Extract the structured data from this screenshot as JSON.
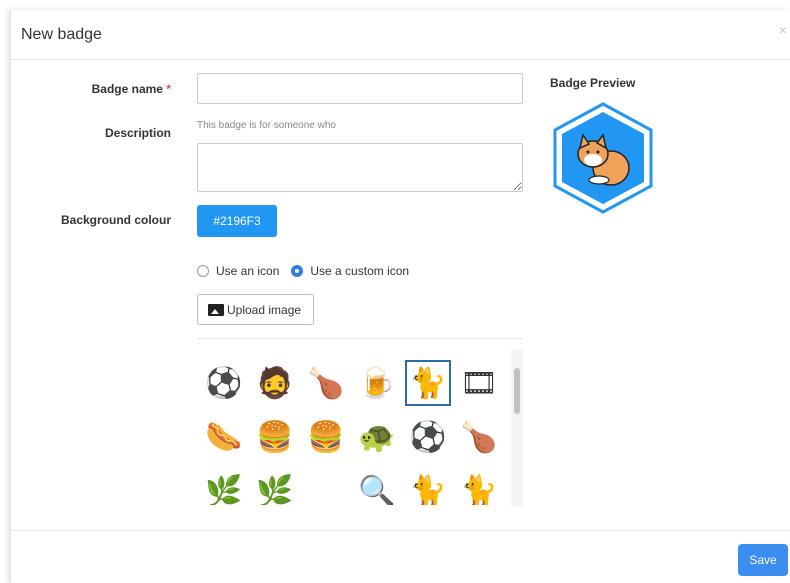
{
  "modal": {
    "title": "New badge",
    "close_glyph": "×"
  },
  "form": {
    "name_label": "Badge name",
    "required_mark": "*",
    "name_value": "",
    "description_label": "Description",
    "description_help": "This badge is for someone who",
    "description_value": "",
    "background_label": "Background colour",
    "background_value": "#2196F3",
    "icon_options": [
      {
        "label": "Use an icon",
        "checked": false
      },
      {
        "label": "Use a custom icon",
        "checked": true
      }
    ],
    "upload_label": "Upload image"
  },
  "icons": [
    {
      "name": "soccer-ball-icon",
      "glyph": "⚽"
    },
    {
      "name": "bearded-man-icon",
      "glyph": "🧔"
    },
    {
      "name": "drumstick-icon",
      "glyph": "🍗"
    },
    {
      "name": "pint-glass-icon",
      "glyph": "🍺"
    },
    {
      "name": "cat-icon",
      "glyph": "🐈",
      "selected": true
    },
    {
      "name": "film-reel-icon",
      "glyph": "🎞"
    },
    {
      "name": "hotdog-icon",
      "glyph": "🌭"
    },
    {
      "name": "burger-icon",
      "glyph": "🍔"
    },
    {
      "name": "burger-icon",
      "glyph": "🍔"
    },
    {
      "name": "turtle-icon",
      "glyph": "🐢"
    },
    {
      "name": "soccer-ball-icon",
      "glyph": "⚽"
    },
    {
      "name": "drumstick-icon",
      "glyph": "🍗"
    },
    {
      "name": "partial-icon",
      "glyph": "🌿"
    },
    {
      "name": "partial-icon",
      "glyph": "🌿"
    },
    {
      "name": "partial-icon",
      "glyph": ""
    },
    {
      "name": "partial-icon",
      "glyph": "🔍"
    },
    {
      "name": "cat-icon",
      "glyph": "🐈"
    },
    {
      "name": "cat-icon",
      "glyph": "🐈"
    }
  ],
  "preview": {
    "title": "Badge Preview",
    "badge_color": "#2196F3",
    "badge_icon": "cat-icon"
  },
  "footer": {
    "save_label": "Save",
    "save_color": "#3b8df0"
  }
}
